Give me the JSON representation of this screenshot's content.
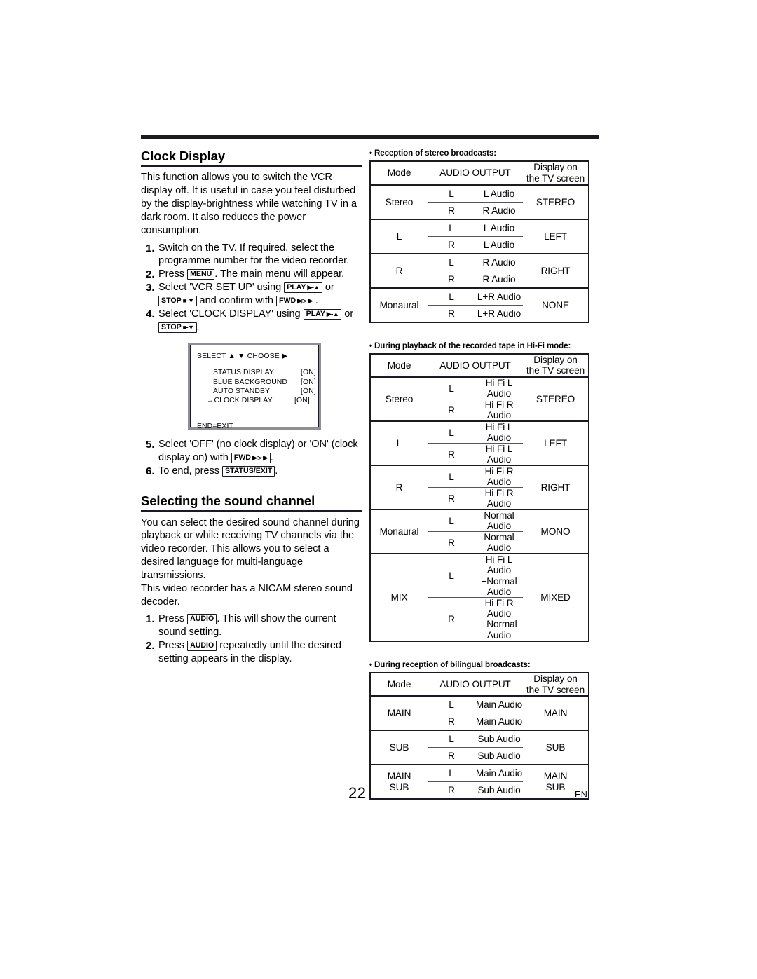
{
  "page": {
    "number": "22",
    "language": "EN"
  },
  "left_column": {
    "section1": {
      "heading": "Clock Display",
      "intro": "This function allows you to switch the VCR display off.  It is useful in case you feel disturbed by the display-brightness while watching TV in a dark room.  It also reduces the power consumption.",
      "steps": [
        {
          "num": "1.",
          "parts": [
            {
              "type": "text",
              "text": "Switch on the TV. If required, select the programme number for the video recorder."
            }
          ]
        },
        {
          "num": "2.",
          "parts": [
            {
              "type": "text",
              "text": "Press "
            },
            {
              "type": "key",
              "label": "MENU"
            },
            {
              "type": "text",
              "text": ". The main menu will appear."
            }
          ]
        },
        {
          "num": "3.",
          "parts": [
            {
              "type": "text",
              "text": "Select 'VCR SET UP' using "
            },
            {
              "type": "key",
              "label": "PLAY",
              "glyph": "▶-▲"
            },
            {
              "type": "text",
              "text": " or "
            },
            {
              "type": "key",
              "label": "STOP",
              "glyph": "■-▼"
            },
            {
              "type": "text",
              "text": " and confirm with "
            },
            {
              "type": "key",
              "label": "FWD",
              "glyph": "▶▷-▶"
            },
            {
              "type": "text",
              "text": "."
            }
          ]
        },
        {
          "num": "4.",
          "parts": [
            {
              "type": "text",
              "text": "Select 'CLOCK DISPLAY' using "
            },
            {
              "type": "key",
              "label": "PLAY",
              "glyph": "▶-▲"
            },
            {
              "type": "text",
              "text": " or "
            },
            {
              "type": "key",
              "label": "STOP",
              "glyph": "■-▼"
            },
            {
              "type": "text",
              "text": "."
            }
          ]
        }
      ],
      "osd_menu": {
        "header": "SELECT ▲ ▼  CHOOSE ▶",
        "items": [
          {
            "pointer": "",
            "label": "STATUS DISPLAY",
            "value": "[ON]"
          },
          {
            "pointer": "",
            "label": "BLUE BACKGROUND",
            "value": "[ON]"
          },
          {
            "pointer": "",
            "label": "AUTO STANDBY",
            "value": "[ON]"
          },
          {
            "pointer": "→",
            "label": "CLOCK DISPLAY",
            "value": "[ON]"
          }
        ],
        "footer": "END=EXIT"
      },
      "steps_after": [
        {
          "num": "5.",
          "parts": [
            {
              "type": "text",
              "text": "Select 'OFF' (no clock display) or 'ON' (clock display on) with "
            },
            {
              "type": "key",
              "label": "FWD",
              "glyph": "▶▷-▶"
            },
            {
              "type": "text",
              "text": "."
            }
          ]
        },
        {
          "num": "6.",
          "parts": [
            {
              "type": "text",
              "text": "To end, press "
            },
            {
              "type": "key",
              "label": "STATUS/EXIT"
            },
            {
              "type": "text",
              "text": "."
            }
          ]
        }
      ]
    },
    "section2": {
      "heading": "Selecting the sound channel",
      "intro1": "You can select the desired sound channel during playback or while receiving TV channels via the video recorder. This allows you to select a desired language for multi-language transmissions.",
      "intro2": "This video recorder has a NICAM stereo sound decoder.",
      "steps": [
        {
          "num": "1.",
          "parts": [
            {
              "type": "text",
              "text": "Press "
            },
            {
              "type": "key",
              "label": "AUDIO"
            },
            {
              "type": "text",
              "text": ". This will show the current sound setting."
            }
          ]
        },
        {
          "num": "2.",
          "parts": [
            {
              "type": "text",
              "text": "Press "
            },
            {
              "type": "key",
              "label": "AUDIO"
            },
            {
              "type": "text",
              "text": " repeatedly until the desired setting appears in the display."
            }
          ]
        }
      ]
    }
  },
  "right_column": {
    "headers": {
      "mode": "Mode",
      "audio_output": "AUDIO OUTPUT",
      "display_line1": "Display on",
      "display_line2": "the TV screen"
    },
    "tables": [
      {
        "caption": "Reception of stereo broadcasts:",
        "rows": [
          {
            "mode": "Stereo",
            "outputs": [
              {
                "ch": "L",
                "audio": "L Audio"
              },
              {
                "ch": "R",
                "audio": "R Audio"
              }
            ],
            "display": "STEREO"
          },
          {
            "mode": "L",
            "outputs": [
              {
                "ch": "L",
                "audio": "L Audio"
              },
              {
                "ch": "R",
                "audio": "L Audio"
              }
            ],
            "display": "LEFT"
          },
          {
            "mode": "R",
            "outputs": [
              {
                "ch": "L",
                "audio": "R Audio"
              },
              {
                "ch": "R",
                "audio": "R Audio"
              }
            ],
            "display": "RIGHT"
          },
          {
            "mode": "Monaural",
            "outputs": [
              {
                "ch": "L",
                "audio": "L+R Audio"
              },
              {
                "ch": "R",
                "audio": "L+R Audio"
              }
            ],
            "display": "NONE"
          }
        ]
      },
      {
        "caption": "During playback of the recorded tape in Hi-Fi mode:",
        "rows": [
          {
            "mode": "Stereo",
            "outputs": [
              {
                "ch": "L",
                "audio": "Hi Fi L Audio"
              },
              {
                "ch": "R",
                "audio": "Hi Fi R Audio"
              }
            ],
            "display": "STEREO"
          },
          {
            "mode": "L",
            "outputs": [
              {
                "ch": "L",
                "audio": "Hi Fi L Audio"
              },
              {
                "ch": "R",
                "audio": "Hi Fi L Audio"
              }
            ],
            "display": "LEFT"
          },
          {
            "mode": "R",
            "outputs": [
              {
                "ch": "L",
                "audio": "Hi Fi R Audio"
              },
              {
                "ch": "R",
                "audio": "Hi Fi R Audio"
              }
            ],
            "display": "RIGHT"
          },
          {
            "mode": "Monaural",
            "outputs": [
              {
                "ch": "L",
                "audio": "Normal Audio"
              },
              {
                "ch": "R",
                "audio": "Normal Audio"
              }
            ],
            "display": "MONO"
          },
          {
            "mode": "MIX",
            "outputs": [
              {
                "ch": "L",
                "audio": "Hi Fi L Audio",
                "audio2": "+Normal Audio"
              },
              {
                "ch": "R",
                "audio": "Hi Fi R Audio",
                "audio2": "+Normal Audio"
              }
            ],
            "display": "MIXED"
          }
        ]
      },
      {
        "caption": "During reception of bilingual broadcasts:",
        "rows": [
          {
            "mode": "MAIN",
            "outputs": [
              {
                "ch": "L",
                "audio": "Main Audio"
              },
              {
                "ch": "R",
                "audio": "Main Audio"
              }
            ],
            "display": "MAIN"
          },
          {
            "mode": "SUB",
            "outputs": [
              {
                "ch": "L",
                "audio": "Sub Audio"
              },
              {
                "ch": "R",
                "audio": "Sub Audio"
              }
            ],
            "display": "SUB"
          },
          {
            "mode": "MAIN\nSUB",
            "mode_lines": [
              "MAIN",
              "SUB"
            ],
            "outputs": [
              {
                "ch": "L",
                "audio": "Main Audio"
              },
              {
                "ch": "R",
                "audio": "Sub Audio"
              }
            ],
            "display_lines": [
              "MAIN",
              "SUB"
            ],
            "display": "MAIN SUB"
          }
        ]
      }
    ]
  }
}
